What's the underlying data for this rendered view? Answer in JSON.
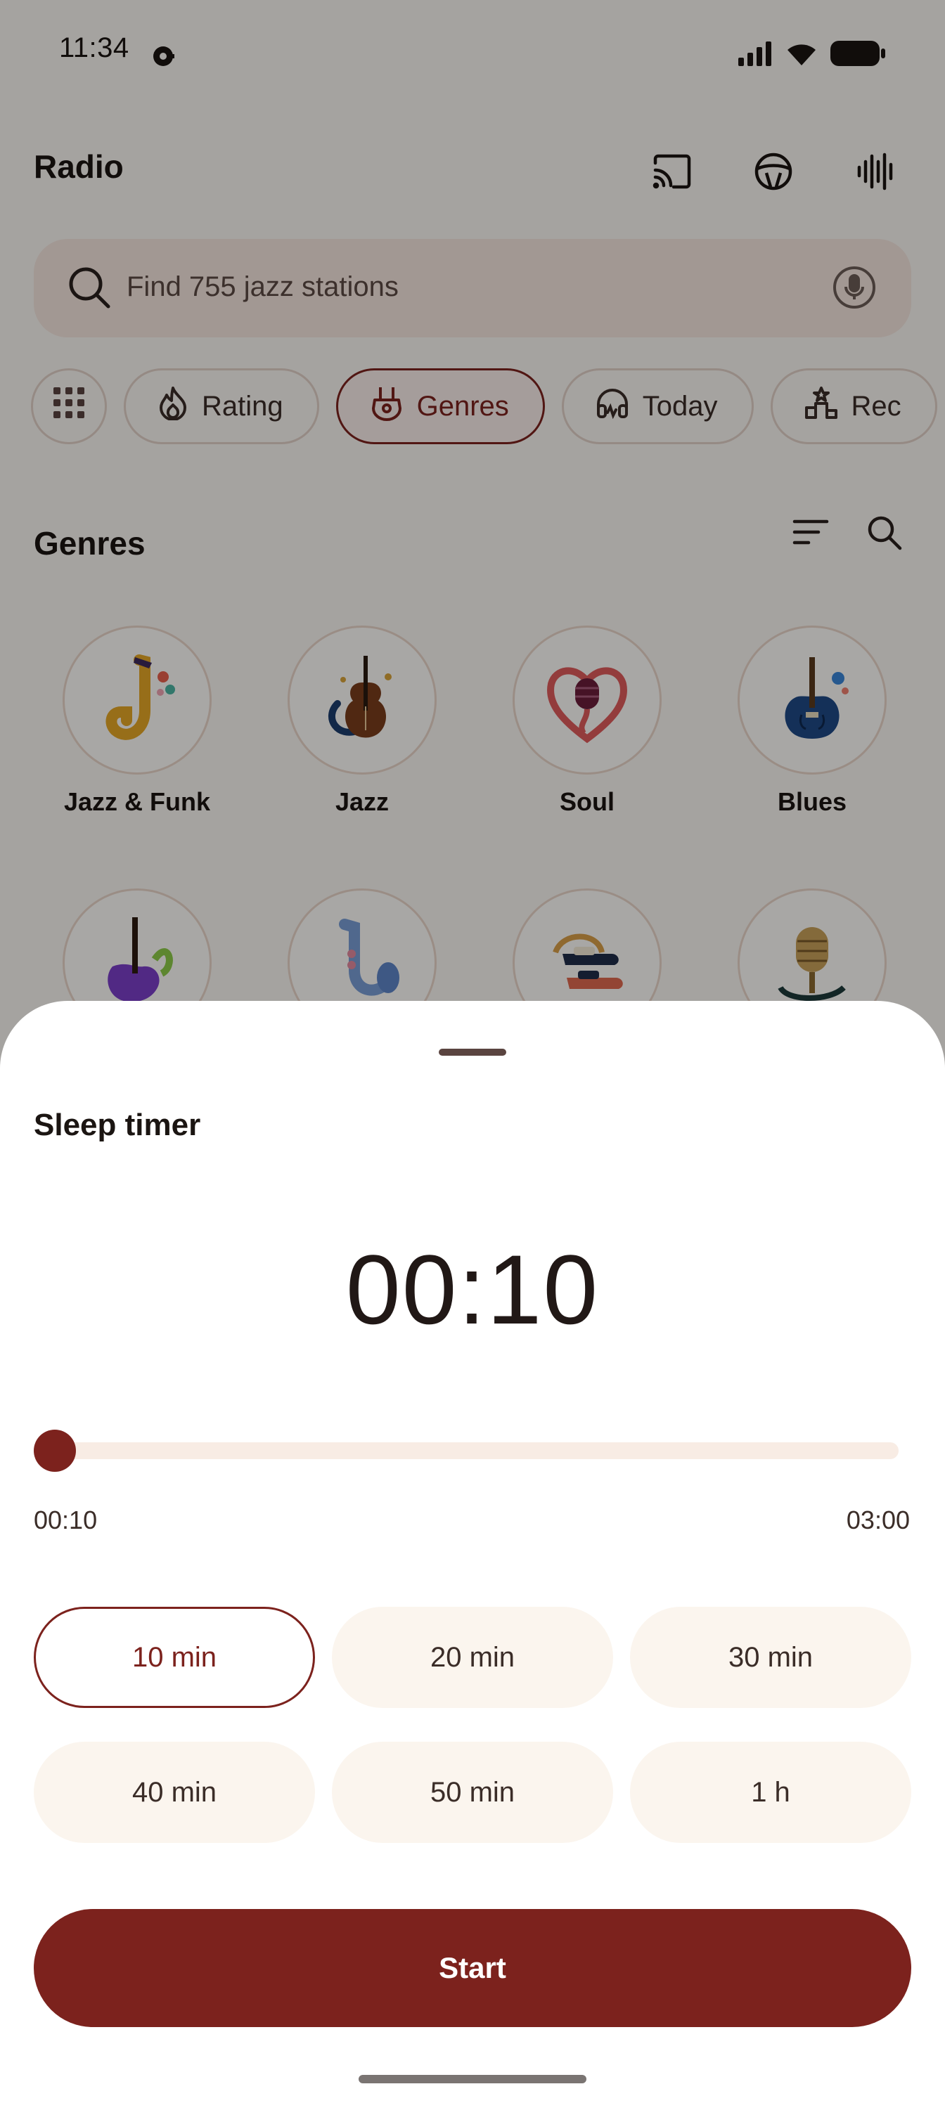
{
  "status_bar": {
    "time": "11:34",
    "icons": [
      "signal-icon",
      "wifi-icon",
      "battery-icon"
    ]
  },
  "app_bar": {
    "title": "Radio",
    "icons": [
      "cast-icon",
      "steering-wheel-icon",
      "audio-waveform-icon"
    ]
  },
  "search": {
    "placeholder": "Find 755 jazz stations"
  },
  "chips": [
    {
      "label": "",
      "icon": "grid-icon"
    },
    {
      "label": "Rating",
      "icon": "flame-icon"
    },
    {
      "label": "Genres",
      "icon": "guitar-icon",
      "active": true
    },
    {
      "label": "Today",
      "icon": "headphones-icon"
    },
    {
      "label": "Rec",
      "icon": "podium-icon"
    }
  ],
  "genres": {
    "title": "Genres",
    "items": [
      {
        "label": "Jazz & Funk",
        "icon": "saxophone-icon"
      },
      {
        "label": "Jazz",
        "icon": "double-bass-icon"
      },
      {
        "label": "Soul",
        "icon": "heart-microphone-icon"
      },
      {
        "label": "Blues",
        "icon": "electric-guitar-icon"
      },
      {
        "label": "",
        "icon": "bass-guitar-icon"
      },
      {
        "label": "",
        "icon": "saxophone-blue-icon"
      },
      {
        "label": "",
        "icon": "dance-shoes-icon"
      },
      {
        "label": "",
        "icon": "vintage-microphone-icon"
      }
    ]
  },
  "sleep_timer": {
    "title": "Sleep timer",
    "display": "00:10",
    "slider": {
      "min_label": "00:10",
      "max_label": "03:00",
      "value_fraction": 0.0
    },
    "presets": [
      {
        "label": "10 min",
        "selected": true
      },
      {
        "label": "20 min"
      },
      {
        "label": "30 min"
      },
      {
        "label": "40 min"
      },
      {
        "label": "50 min"
      },
      {
        "label": "1 h"
      }
    ],
    "start_label": "Start"
  },
  "colors": {
    "accent": "#7c221d",
    "chip_border": "#e3d2c8",
    "preset_bg": "#fbf5ee",
    "search_bg": "#f6e7df"
  }
}
